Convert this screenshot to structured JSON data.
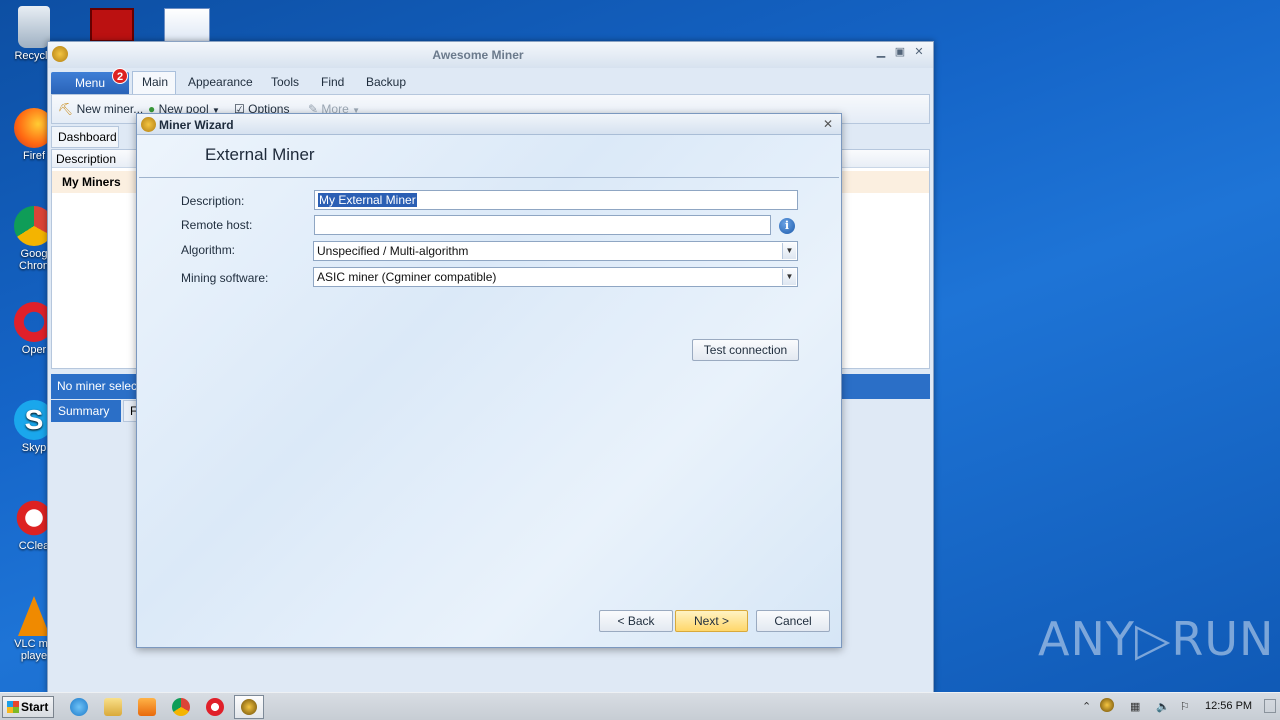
{
  "desktop": {
    "icons": [
      {
        "label": "Recycle",
        "name": "recycle-bin-icon"
      },
      {
        "label": "Firef",
        "name": "firefox-icon"
      },
      {
        "label": "Goog Chron",
        "name": "chrome-icon"
      },
      {
        "label": "Oper",
        "name": "opera-icon"
      },
      {
        "label": "Skyp",
        "name": "skype-icon"
      },
      {
        "label": "CClea",
        "name": "ccleaner-icon"
      },
      {
        "label": "VLC me playe",
        "name": "vlc-icon"
      }
    ],
    "watermark": "ANY▷RUN"
  },
  "main_window": {
    "title": "Awesome Miner",
    "menu_label": "Menu",
    "menu_badge": "2",
    "tabs": [
      "Main",
      "Appearance",
      "Tools",
      "Find",
      "Backup"
    ],
    "toolbar": {
      "new_miner": "New miner...",
      "new_pool": "New pool",
      "options": "Options",
      "more": "More"
    },
    "dashboard_tab": "Dashboard",
    "grid_header": "Description",
    "group_label": "My Miners",
    "status_text": "No miner selecte",
    "bottom_tabs": [
      "Summary",
      "F"
    ]
  },
  "wizard": {
    "title": "Miner Wizard",
    "heading": "External Miner",
    "fields": {
      "description_label": "Description:",
      "description_value": "My External Miner",
      "remote_host_label": "Remote host:",
      "remote_host_value": "",
      "algorithm_label": "Algorithm:",
      "algorithm_value": "Unspecified / Multi-algorithm",
      "software_label": "Mining software:",
      "software_value": "ASIC miner (Cgminer compatible)"
    },
    "test_connection": "Test connection",
    "back": "< Back",
    "next": "Next >",
    "cancel": "Cancel"
  },
  "taskbar": {
    "start": "Start",
    "clock": "12:56 PM"
  },
  "colors": {
    "accent": "#2b6fc7",
    "desktop": "#1565c8",
    "next_button": "#ffd76a"
  }
}
